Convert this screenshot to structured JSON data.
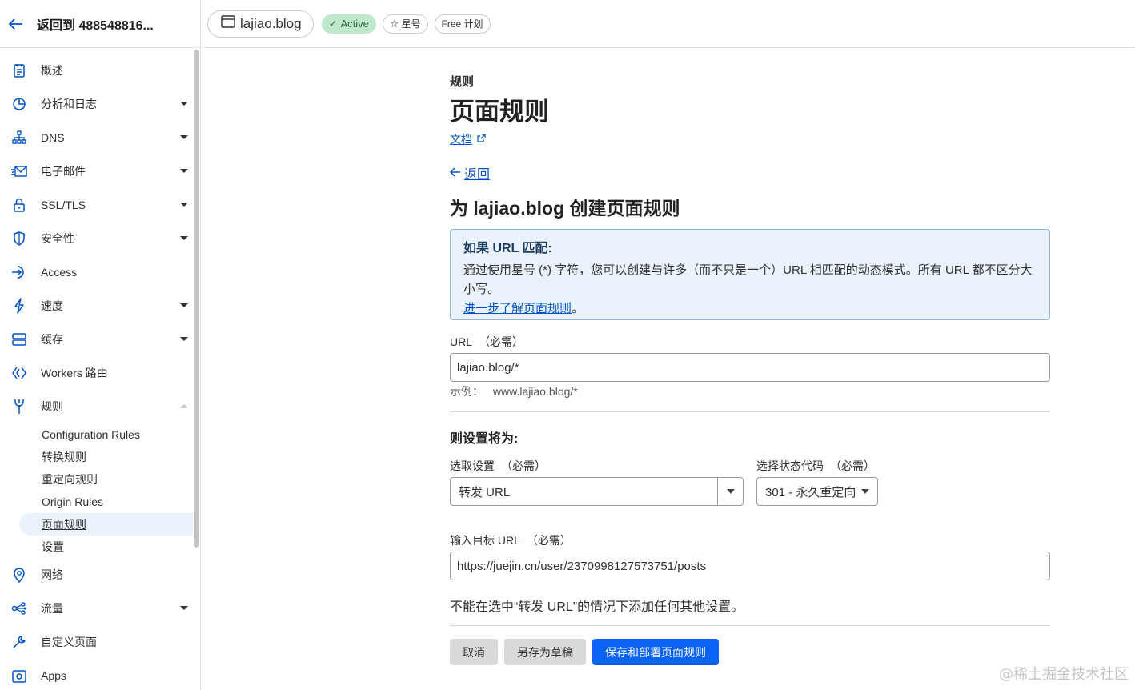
{
  "sidebar": {
    "back_label": "返回到 488548816...",
    "items": [
      {
        "label": "概述",
        "icon": "document-icon"
      },
      {
        "label": "分析和日志",
        "icon": "chart-icon",
        "caret": "down"
      },
      {
        "label": "DNS",
        "icon": "network-icon",
        "caret": "down"
      },
      {
        "label": "电子邮件",
        "icon": "email-icon",
        "caret": "down"
      },
      {
        "label": "SSL/TLS",
        "icon": "lock-icon",
        "caret": "down"
      },
      {
        "label": "安全性",
        "icon": "shield-icon",
        "caret": "down"
      },
      {
        "label": "Access",
        "icon": "access-icon"
      },
      {
        "label": "速度",
        "icon": "lightning-icon",
        "caret": "down"
      },
      {
        "label": "缓存",
        "icon": "cache-icon",
        "caret": "down"
      },
      {
        "label": "Workers 路由",
        "icon": "workers-icon"
      },
      {
        "label": "规则",
        "icon": "rules-icon",
        "caret": "up"
      }
    ],
    "rules_sub": [
      "Configuration Rules",
      "转换规则",
      "重定向规则",
      "Origin Rules",
      "页面规则",
      "设置"
    ],
    "items_after": [
      {
        "label": "网络",
        "icon": "location-icon"
      },
      {
        "label": "流量",
        "icon": "traffic-icon",
        "caret": "down"
      },
      {
        "label": "自定义页面",
        "icon": "wrench-icon"
      },
      {
        "label": "Apps",
        "icon": "apps-icon"
      }
    ]
  },
  "topbar": {
    "domain": "lajiao.blog",
    "status": "Active",
    "star_label": "星号",
    "plan": "Free 计划"
  },
  "main": {
    "eyebrow": "规则",
    "title": "页面规则",
    "docs_link": "文档",
    "back_link": "返回",
    "form_title": "为 lajiao.blog 创建页面规则",
    "info": {
      "heading": "如果 URL 匹配:",
      "body": "通过使用星号 (*) 字符，您可以创建与许多（而不只是一个）URL 相匹配的动态模式。所有 URL 都不区分大小写。",
      "link": "进一步了解页面规则",
      "link_suffix": "。"
    },
    "url_label": "URL",
    "required": "（必需）",
    "url_value": "lajiao.blog/*",
    "example_label": "示例：",
    "example_value": "www.lajiao.blog/*",
    "settings_heading": "则设置将为:",
    "pick_setting_label": "选取设置",
    "pick_setting_value": "转发 URL",
    "status_code_label": "选择状态代码",
    "status_code_value": "301 - 永久重定向",
    "dest_label": "输入目标 URL",
    "dest_value": "https://juejin.cn/user/2370998127573751/posts",
    "note": "不能在选中“转发 URL”的情况下添加任何其他设置。",
    "buttons": {
      "cancel": "取消",
      "save_draft": "另存为草稿",
      "save_deploy": "保存和部署页面规则"
    }
  },
  "watermark": "@稀土掘金技术社区"
}
